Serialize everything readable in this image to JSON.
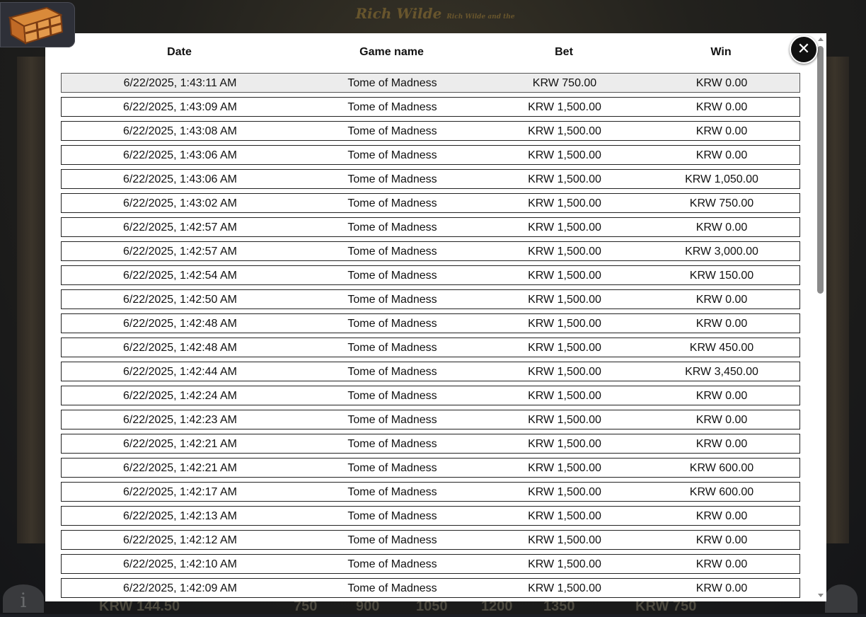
{
  "game": {
    "logo_text": "Rich Wilde and the",
    "bottom_values": [
      "KRW 144.50",
      "750",
      "900",
      "1050",
      "1200",
      "1350",
      "KRW 750"
    ]
  },
  "icons": {
    "chest": "treasure-chest-icon",
    "close": "close-icon",
    "info": "info-icon"
  },
  "history": {
    "columns": {
      "date": "Date",
      "game_name": "Game name",
      "bet": "Bet",
      "win": "Win"
    },
    "rows": [
      {
        "date": "6/22/2025, 1:43:11 AM",
        "game": "Tome of Madness",
        "bet": "KRW 750.00",
        "win": "KRW 0.00"
      },
      {
        "date": "6/22/2025, 1:43:09 AM",
        "game": "Tome of Madness",
        "bet": "KRW 1,500.00",
        "win": "KRW 0.00"
      },
      {
        "date": "6/22/2025, 1:43:08 AM",
        "game": "Tome of Madness",
        "bet": "KRW 1,500.00",
        "win": "KRW 0.00"
      },
      {
        "date": "6/22/2025, 1:43:06 AM",
        "game": "Tome of Madness",
        "bet": "KRW 1,500.00",
        "win": "KRW 0.00"
      },
      {
        "date": "6/22/2025, 1:43:06 AM",
        "game": "Tome of Madness",
        "bet": "KRW 1,500.00",
        "win": "KRW 1,050.00"
      },
      {
        "date": "6/22/2025, 1:43:02 AM",
        "game": "Tome of Madness",
        "bet": "KRW 1,500.00",
        "win": "KRW 750.00"
      },
      {
        "date": "6/22/2025, 1:42:57 AM",
        "game": "Tome of Madness",
        "bet": "KRW 1,500.00",
        "win": "KRW 0.00"
      },
      {
        "date": "6/22/2025, 1:42:57 AM",
        "game": "Tome of Madness",
        "bet": "KRW 1,500.00",
        "win": "KRW 3,000.00"
      },
      {
        "date": "6/22/2025, 1:42:54 AM",
        "game": "Tome of Madness",
        "bet": "KRW 1,500.00",
        "win": "KRW 150.00"
      },
      {
        "date": "6/22/2025, 1:42:50 AM",
        "game": "Tome of Madness",
        "bet": "KRW 1,500.00",
        "win": "KRW 0.00"
      },
      {
        "date": "6/22/2025, 1:42:48 AM",
        "game": "Tome of Madness",
        "bet": "KRW 1,500.00",
        "win": "KRW 0.00"
      },
      {
        "date": "6/22/2025, 1:42:48 AM",
        "game": "Tome of Madness",
        "bet": "KRW 1,500.00",
        "win": "KRW 450.00"
      },
      {
        "date": "6/22/2025, 1:42:44 AM",
        "game": "Tome of Madness",
        "bet": "KRW 1,500.00",
        "win": "KRW 3,450.00"
      },
      {
        "date": "6/22/2025, 1:42:24 AM",
        "game": "Tome of Madness",
        "bet": "KRW 1,500.00",
        "win": "KRW 0.00"
      },
      {
        "date": "6/22/2025, 1:42:23 AM",
        "game": "Tome of Madness",
        "bet": "KRW 1,500.00",
        "win": "KRW 0.00"
      },
      {
        "date": "6/22/2025, 1:42:21 AM",
        "game": "Tome of Madness",
        "bet": "KRW 1,500.00",
        "win": "KRW 0.00"
      },
      {
        "date": "6/22/2025, 1:42:21 AM",
        "game": "Tome of Madness",
        "bet": "KRW 1,500.00",
        "win": "KRW 600.00"
      },
      {
        "date": "6/22/2025, 1:42:17 AM",
        "game": "Tome of Madness",
        "bet": "KRW 1,500.00",
        "win": "KRW 600.00"
      },
      {
        "date": "6/22/2025, 1:42:13 AM",
        "game": "Tome of Madness",
        "bet": "KRW 1,500.00",
        "win": "KRW 0.00"
      },
      {
        "date": "6/22/2025, 1:42:12 AM",
        "game": "Tome of Madness",
        "bet": "KRW 1,500.00",
        "win": "KRW 0.00"
      },
      {
        "date": "6/22/2025, 1:42:10 AM",
        "game": "Tome of Madness",
        "bet": "KRW 1,500.00",
        "win": "KRW 0.00"
      },
      {
        "date": "6/22/2025, 1:42:09 AM",
        "game": "Tome of Madness",
        "bet": "KRW 1,500.00",
        "win": "KRW 0.00"
      }
    ]
  },
  "close_label": "✕"
}
